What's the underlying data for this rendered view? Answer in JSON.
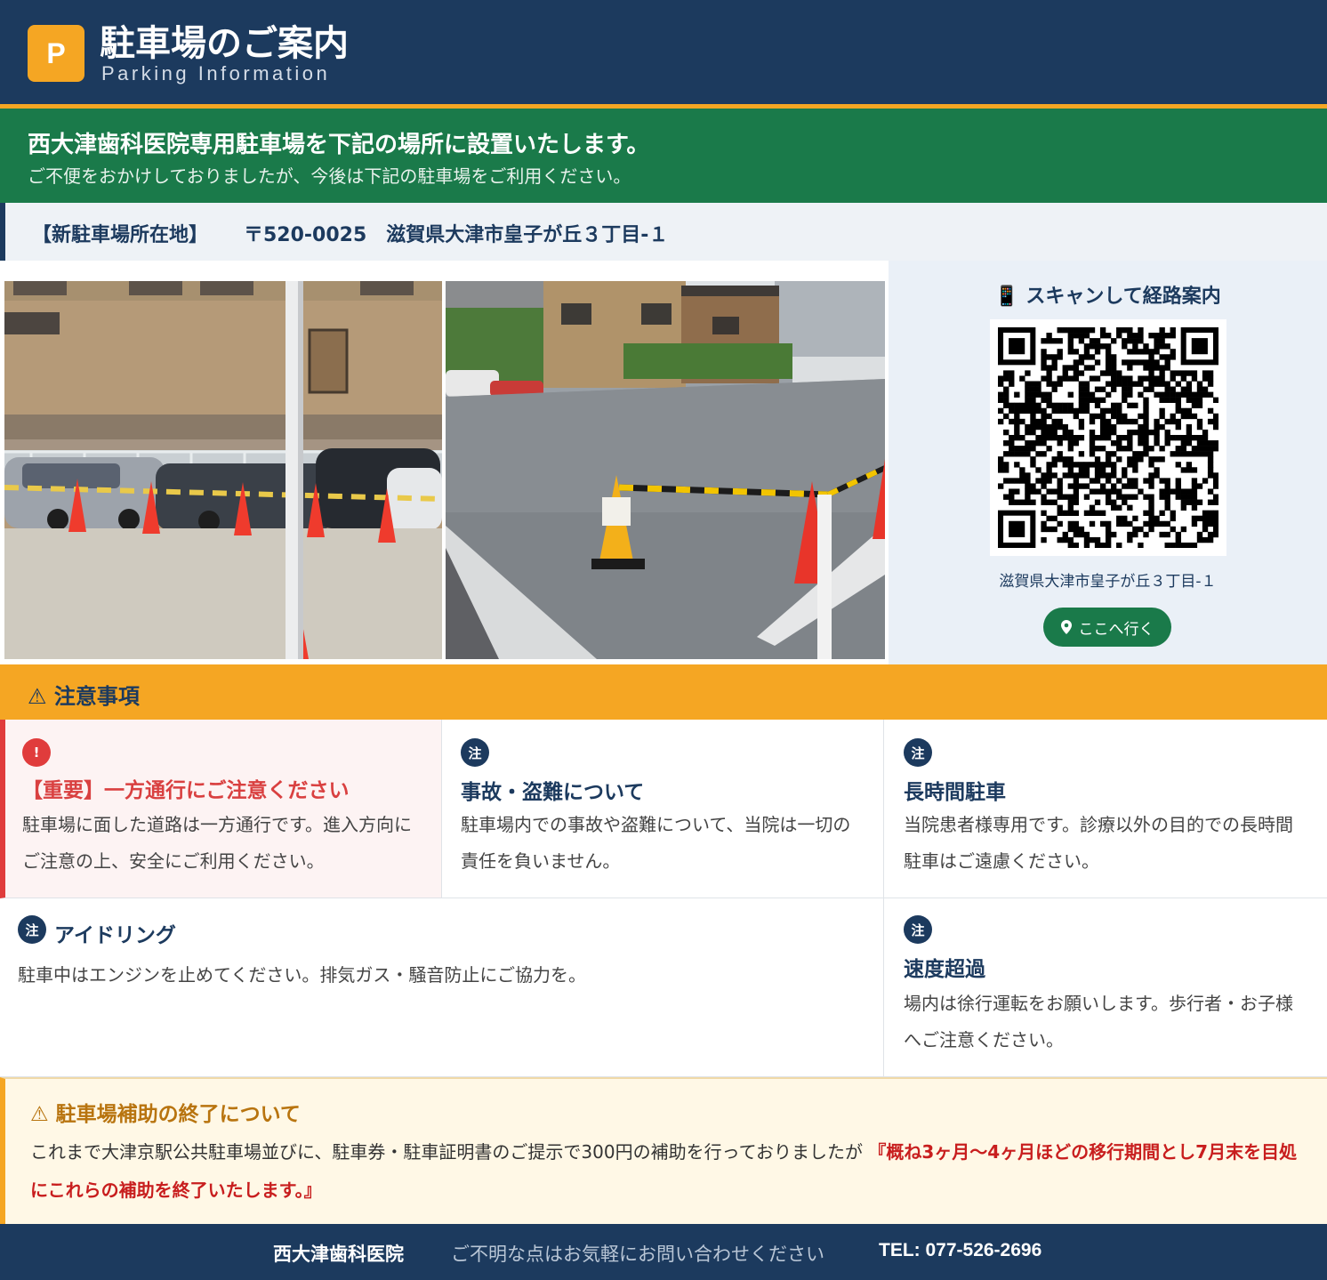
{
  "header": {
    "logo": "P",
    "title": "駐車場のご案内",
    "subtitle": "Parking Information"
  },
  "announcement": {
    "main": "西大津歯科医院専用駐車場を下記の場所に設置いたします。",
    "sub": "ご不便をおかけしておりましたが、今後は下記の駐車場をご利用ください。"
  },
  "address_bar": {
    "label": "【新駐車場所在地】",
    "address": "〒520-0025　滋賀県大津市皇子が丘３丁目-１"
  },
  "qr_panel": {
    "icon": "mobile-phone-icon",
    "title": "📱 スキャンして経路案内",
    "address": "滋賀県大津市皇子が丘３丁目-１",
    "button_label": "ここへ行く"
  },
  "notice": {
    "heading": "⚠ 注意事項",
    "cards": [
      {
        "badge": "!",
        "title": "【重要】一方通行にご注意ください",
        "body": "駐車場に面した道路は一方通行です。進入方向にご注意の上、安全にご利用ください。"
      },
      {
        "badge": "注",
        "title": "事故・盗難について",
        "body": "駐車場内での事故や盗難について、当院は一切の責任を負いません。"
      },
      {
        "badge": "注",
        "title": "長時間駐車",
        "body": "当院患者様専用です。診療以外の目的での長時間駐車はご遠慮ください。"
      },
      {
        "badge": "注",
        "title": "アイドリング",
        "body": "駐車中はエンジンを止めてください。排気ガス・騒音防止にご協力を。"
      },
      {
        "badge": "注",
        "title": "速度超過",
        "body": "場内は徐行運転をお願いします。歩行者・お子様へご注意ください。"
      }
    ]
  },
  "subsidy": {
    "title": "⚠ 駐車場補助の終了について",
    "body": "これまで大津京駅公共駐車場並びに、駐車券・駐車証明書のご提示で300円の補助を行っておりましたが",
    "emphasis": "『概ね3ヶ月〜4ヶ月ほどの移行期間とし7月末を目処にこれらの補助を終了いたします。』"
  },
  "footer": {
    "clinic": "西大津歯科医院",
    "message": "ご不明な点はお気軽にお問い合わせください",
    "tel": "TEL: 077-526-2696"
  },
  "colors": {
    "navy": "#1c3a5e",
    "orange": "#f5a623",
    "green": "#1a7a4a",
    "red": "#e03c3c"
  }
}
